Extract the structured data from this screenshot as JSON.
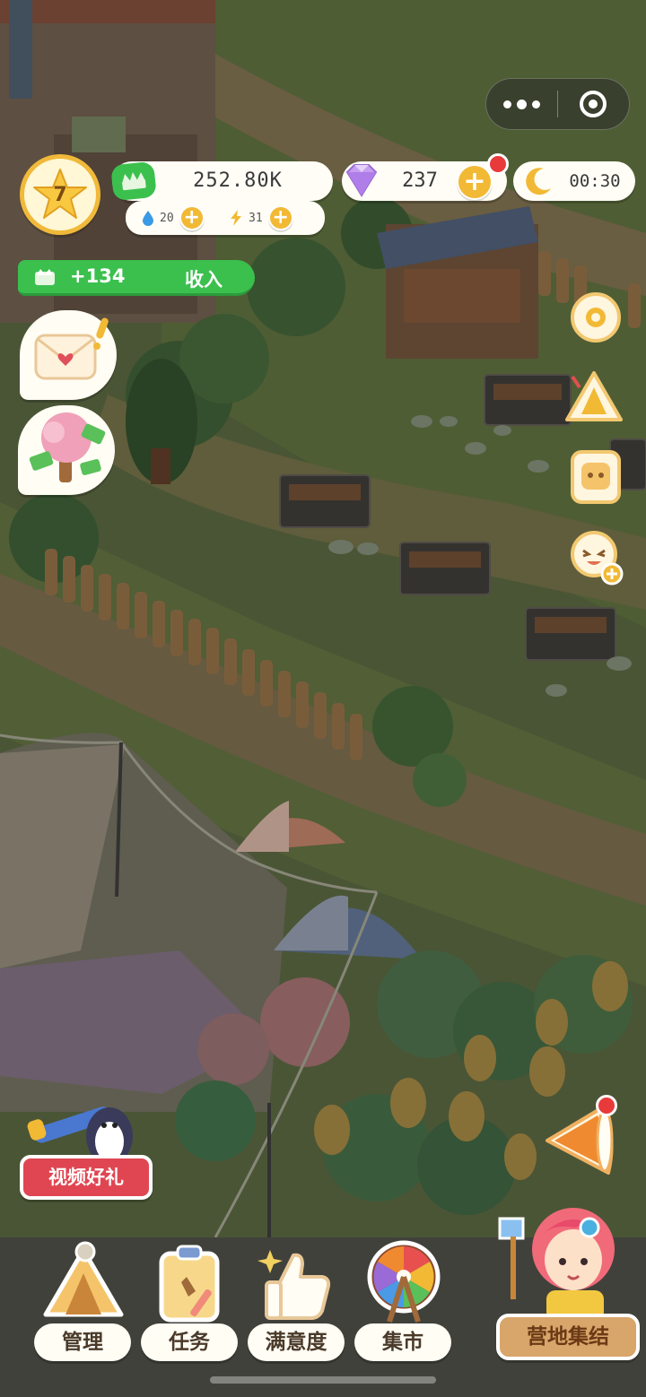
{
  "system": {
    "capsule": {
      "more_icon": "more-dots-icon",
      "close_icon": "target-close-icon"
    }
  },
  "player": {
    "level": "7"
  },
  "resources": {
    "coins": "252.80K",
    "water": "20",
    "energy": "31",
    "gems": "237",
    "timer": "00:30"
  },
  "income": {
    "amount": "+134",
    "label": "收入"
  },
  "side_icons": [
    "settings-gear-icon",
    "tent-icon",
    "toast-card-icon",
    "emoji-add-icon"
  ],
  "promo": {
    "video_gift": "视频好礼"
  },
  "nav": {
    "items": [
      {
        "label": "管理",
        "icon": "tent-manage-icon"
      },
      {
        "label": "任务",
        "icon": "clipboard-task-icon"
      },
      {
        "label": "满意度",
        "icon": "thumbs-up-icon"
      },
      {
        "label": "集市",
        "icon": "ferris-wheel-icon"
      }
    ],
    "gather": "营地集结"
  },
  "colors": {
    "green": "#3bc04e",
    "gold": "#f2b935",
    "red": "#e83a3a",
    "cream": "#fffdf4"
  }
}
